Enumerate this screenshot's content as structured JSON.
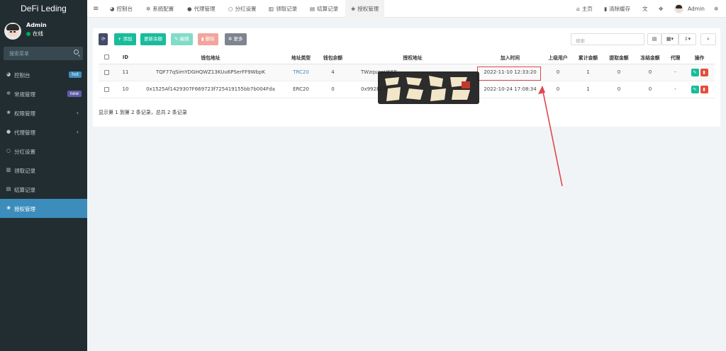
{
  "sidebar": {
    "brand": "DeFi Leding",
    "user_name": "Admin",
    "user_status": "在线",
    "search_placeholder": "搜索菜单",
    "items": [
      {
        "label": "控制台",
        "icon": "dashboard-icon",
        "badge": "hot",
        "badge_color": "#3c8dbc"
      },
      {
        "label": "常规管理",
        "icon": "cogs-icon",
        "badge": "new",
        "badge_color": "#605ca8"
      },
      {
        "label": "权限管理",
        "icon": "group-icon",
        "chevron": "‹"
      },
      {
        "label": "代理管理",
        "icon": "user-icon",
        "chevron": "‹"
      },
      {
        "label": "分红设置",
        "icon": "circle-icon"
      },
      {
        "label": "领取记录",
        "icon": "bank-icon"
      },
      {
        "label": "结算记录",
        "icon": "list-icon"
      },
      {
        "label": "授权管理",
        "icon": "users-icon",
        "active": true
      }
    ]
  },
  "topbar": {
    "tabs": [
      "控制台",
      "系统配置",
      "代理管理",
      "分红设置",
      "领取记录",
      "结算记录",
      "授权管理"
    ],
    "home": "主页",
    "clear_cache": "清除缓存",
    "admin": "Admin"
  },
  "toolbar": {
    "add": "添加",
    "update_balance": "更新余额",
    "edit": "编辑",
    "delete": "删除",
    "more": "更多",
    "search_placeholder": "搜索"
  },
  "table": {
    "headers": [
      "ID",
      "钱包地址",
      "地址类型",
      "钱包余额",
      "授权地址",
      "加入时间",
      "上级用户",
      "累计金额",
      "提取金额",
      "冻结金额",
      "代理",
      "操作"
    ],
    "rows": [
      {
        "id": "11",
        "wallet": "TQF77qSimYDGHQWZ13KUu6PSerFF9WbpK",
        "type": "TRC20",
        "balance": "4",
        "auth": "TWzqueaVK6R",
        "time": "2022-11-10 12:33:20",
        "parent": "0",
        "total": "1",
        "withdraw": "0",
        "frozen": "0",
        "agent": "-"
      },
      {
        "id": "10",
        "wallet": "0x1525Af1429307F669723f725419155bb7b004Fda",
        "type": "ERC20",
        "balance": "0",
        "auth": "0x992E37A808C",
        "time": "2022-10-24 17:08:34",
        "parent": "0",
        "total": "1",
        "withdraw": "0",
        "frozen": "0",
        "agent": "-"
      }
    ],
    "footer": "显示第 1 到第 2 条记录，总共 2 条记录"
  },
  "colors": {
    "sidebar": "#222d32",
    "active": "#3c8dbc",
    "teal": "#18bc9c",
    "red": "#e74c3c",
    "trc": "#3c8dbc",
    "arrow": "#e0474c"
  }
}
